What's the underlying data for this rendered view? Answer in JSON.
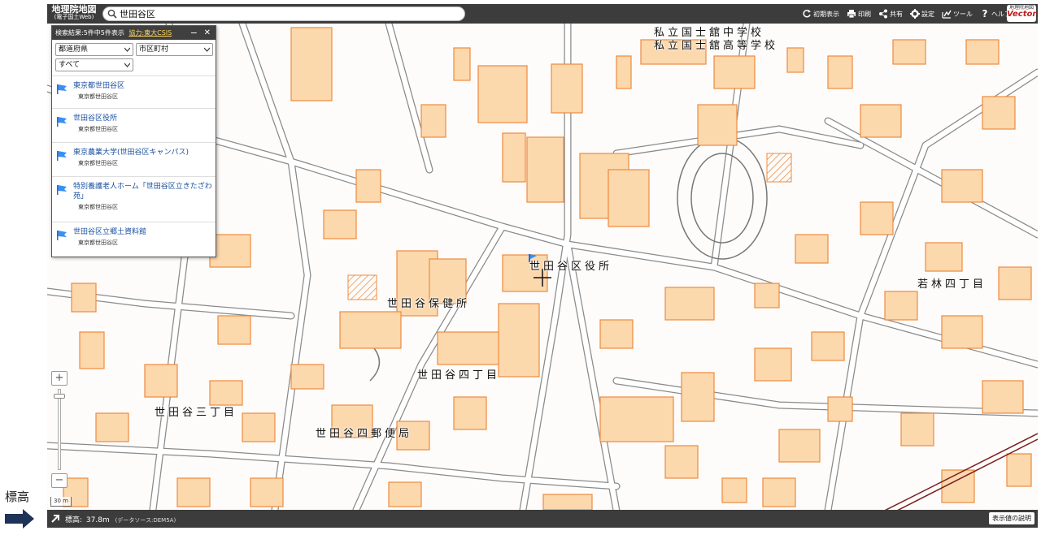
{
  "outer": {
    "label": "標高"
  },
  "header": {
    "logo_main": "地理院地図",
    "logo_sub": "(電子国土Web)",
    "search_value": "世田谷区",
    "tools": [
      {
        "name": "reset-view",
        "icon": "refresh-icon",
        "label": "初期表示"
      },
      {
        "name": "print",
        "icon": "printer-icon",
        "label": "印刷"
      },
      {
        "name": "share",
        "icon": "share-icon",
        "label": "共有"
      },
      {
        "name": "settings",
        "icon": "gear-icon",
        "label": "設定"
      },
      {
        "name": "tools",
        "icon": "tool-icon",
        "label": "ツール"
      },
      {
        "name": "help",
        "icon": "help-icon",
        "label": "ヘルプ"
      }
    ],
    "badge_top": "地理院地図",
    "badge_text": "Vector"
  },
  "panel": {
    "title": "検索結果:5件中5件表示",
    "credit": "協力:東大CSIS",
    "prefecture": "都道府県",
    "city": "市区町村",
    "filter": "すべて",
    "results": [
      {
        "name": "東京都世田谷区",
        "address": "東京都世田谷区"
      },
      {
        "name": "世田谷区役所",
        "address": "東京都世田谷区"
      },
      {
        "name": "東京農業大学(世田谷区キャンパス)",
        "address": "東京都世田谷区"
      },
      {
        "name": "特別養護老人ホーム「世田谷区立きたざわ苑」",
        "address": "東京都世田谷区"
      },
      {
        "name": "世田谷区立郷土資料館",
        "address": "東京都世田谷区"
      }
    ]
  },
  "map": {
    "labels": [
      "私立国士舘中学校",
      "私立国士舘高等学校",
      "世田谷区役所",
      "若林四丁目",
      "世田谷保健所",
      "世田谷四丁目",
      "世田谷三丁目",
      "世田谷四郵便局"
    ],
    "colors": {
      "building_fill": "#fcd8ad",
      "building_edge": "#ee8a3f",
      "road": "#ffffff",
      "road_edge": "#888888",
      "rail": "#7a1f1f"
    }
  },
  "zoom": {
    "in": "+",
    "out": "−",
    "scale": "30 m"
  },
  "footer": {
    "elevation_label": "標高:",
    "elevation_value": "37.8m",
    "source": "(データソース:DEM5A)",
    "legend_button": "表示値の説明"
  }
}
